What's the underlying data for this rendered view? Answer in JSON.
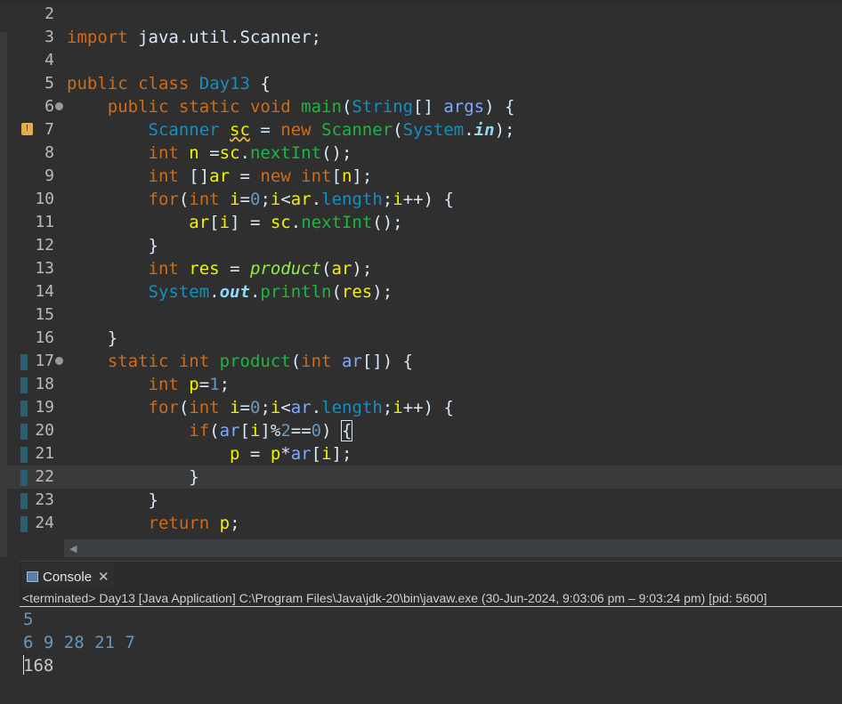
{
  "editor": {
    "lines": [
      {
        "n": "2",
        "tokens": []
      },
      {
        "n": "3",
        "tokens": [
          [
            "kw",
            "import"
          ],
          [
            "pl",
            " java.util.Scanner;"
          ]
        ]
      },
      {
        "n": "4",
        "tokens": []
      },
      {
        "n": "5",
        "tokens": [
          [
            "kw",
            "public"
          ],
          [
            "pl",
            " "
          ],
          [
            "kw",
            "class"
          ],
          [
            "pl",
            " "
          ],
          [
            "ty",
            "Day13"
          ],
          [
            "pl",
            " {"
          ]
        ]
      },
      {
        "n": "6",
        "fold": true,
        "tokens": [
          [
            "pl",
            "    "
          ],
          [
            "kw",
            "public"
          ],
          [
            "pl",
            " "
          ],
          [
            "kw",
            "static"
          ],
          [
            "pl",
            " "
          ],
          [
            "kw",
            "void"
          ],
          [
            "pl",
            " "
          ],
          [
            "fn",
            "main"
          ],
          [
            "pl",
            "("
          ],
          [
            "ty",
            "String"
          ],
          [
            "pl",
            "[] "
          ],
          [
            "var",
            "args"
          ],
          [
            "pl",
            ") {"
          ]
        ]
      },
      {
        "n": "7",
        "warn": true,
        "tokens": [
          [
            "pl",
            "        "
          ],
          [
            "ty",
            "Scanner"
          ],
          [
            "pl",
            " "
          ],
          [
            "loc squig",
            "sc"
          ],
          [
            "pl",
            " = "
          ],
          [
            "kw",
            "new"
          ],
          [
            "pl",
            " "
          ],
          [
            "fn",
            "Scanner"
          ],
          [
            "pl",
            "("
          ],
          [
            "ty",
            "System"
          ],
          [
            "pl",
            "."
          ],
          [
            "fldi",
            "in"
          ],
          [
            "pl",
            ");"
          ]
        ]
      },
      {
        "n": "8",
        "tokens": [
          [
            "pl",
            "        "
          ],
          [
            "kw",
            "int"
          ],
          [
            "pl",
            " "
          ],
          [
            "loc",
            "n"
          ],
          [
            "pl",
            " ="
          ],
          [
            "loc",
            "sc"
          ],
          [
            "pl",
            "."
          ],
          [
            "fn",
            "nextInt"
          ],
          [
            "pl",
            "();"
          ]
        ]
      },
      {
        "n": "9",
        "tokens": [
          [
            "pl",
            "        "
          ],
          [
            "kw",
            "int"
          ],
          [
            "pl",
            " []"
          ],
          [
            "loc",
            "ar"
          ],
          [
            "pl",
            " = "
          ],
          [
            "kw",
            "new"
          ],
          [
            "pl",
            " "
          ],
          [
            "kw",
            "int"
          ],
          [
            "pl",
            "["
          ],
          [
            "loc",
            "n"
          ],
          [
            "pl",
            "];"
          ]
        ]
      },
      {
        "n": "10",
        "tokens": [
          [
            "pl",
            "        "
          ],
          [
            "kw",
            "for"
          ],
          [
            "pl",
            "("
          ],
          [
            "kw",
            "int"
          ],
          [
            "pl",
            " "
          ],
          [
            "loc",
            "i"
          ],
          [
            "pl",
            "="
          ],
          [
            "num",
            "0"
          ],
          [
            "pl",
            ";"
          ],
          [
            "loc",
            "i"
          ],
          [
            "pl",
            "<"
          ],
          [
            "loc",
            "ar"
          ],
          [
            "pl",
            "."
          ],
          [
            "ty",
            "length"
          ],
          [
            "pl",
            ";"
          ],
          [
            "loc",
            "i"
          ],
          [
            "pl",
            "++) {"
          ]
        ]
      },
      {
        "n": "11",
        "tokens": [
          [
            "pl",
            "            "
          ],
          [
            "loc",
            "ar"
          ],
          [
            "pl",
            "["
          ],
          [
            "loc",
            "i"
          ],
          [
            "pl",
            "] = "
          ],
          [
            "loc",
            "sc"
          ],
          [
            "pl",
            "."
          ],
          [
            "fn",
            "nextInt"
          ],
          [
            "pl",
            "();"
          ]
        ]
      },
      {
        "n": "12",
        "tokens": [
          [
            "pl",
            "        }"
          ]
        ]
      },
      {
        "n": "13",
        "tokens": [
          [
            "pl",
            "        "
          ],
          [
            "kw",
            "int"
          ],
          [
            "pl",
            " "
          ],
          [
            "loc",
            "res"
          ],
          [
            "pl",
            " = "
          ],
          [
            "sta",
            "product"
          ],
          [
            "pl",
            "("
          ],
          [
            "loc",
            "ar"
          ],
          [
            "pl",
            ");"
          ]
        ]
      },
      {
        "n": "14",
        "tokens": [
          [
            "pl",
            "        "
          ],
          [
            "ty",
            "System"
          ],
          [
            "pl",
            "."
          ],
          [
            "fldi",
            "out"
          ],
          [
            "pl",
            "."
          ],
          [
            "fn",
            "println"
          ],
          [
            "pl",
            "("
          ],
          [
            "loc",
            "res"
          ],
          [
            "pl",
            ");"
          ]
        ]
      },
      {
        "n": "15",
        "tokens": []
      },
      {
        "n": "16",
        "tokens": [
          [
            "pl",
            "    }"
          ]
        ]
      },
      {
        "n": "17",
        "fold": true,
        "qd": true,
        "tokens": [
          [
            "pl",
            "    "
          ],
          [
            "kw",
            "static"
          ],
          [
            "pl",
            " "
          ],
          [
            "kw",
            "int"
          ],
          [
            "pl",
            " "
          ],
          [
            "fn",
            "product"
          ],
          [
            "pl",
            "("
          ],
          [
            "kw",
            "int"
          ],
          [
            "pl",
            " "
          ],
          [
            "var",
            "ar"
          ],
          [
            "pl",
            "[]) {"
          ]
        ]
      },
      {
        "n": "18",
        "qd": true,
        "tokens": [
          [
            "pl",
            "        "
          ],
          [
            "kw",
            "int"
          ],
          [
            "pl",
            " "
          ],
          [
            "loc",
            "p"
          ],
          [
            "pl",
            "="
          ],
          [
            "num",
            "1"
          ],
          [
            "pl",
            ";"
          ]
        ]
      },
      {
        "n": "19",
        "qd": true,
        "tokens": [
          [
            "pl",
            "        "
          ],
          [
            "kw",
            "for"
          ],
          [
            "pl",
            "("
          ],
          [
            "kw",
            "int"
          ],
          [
            "pl",
            " "
          ],
          [
            "loc",
            "i"
          ],
          [
            "pl",
            "="
          ],
          [
            "num",
            "0"
          ],
          [
            "pl",
            ";"
          ],
          [
            "loc",
            "i"
          ],
          [
            "pl",
            "<"
          ],
          [
            "var",
            "ar"
          ],
          [
            "pl",
            "."
          ],
          [
            "ty",
            "length"
          ],
          [
            "pl",
            ";"
          ],
          [
            "loc",
            "i"
          ],
          [
            "pl",
            "++) {"
          ]
        ]
      },
      {
        "n": "20",
        "qd": true,
        "tokens": [
          [
            "pl",
            "            "
          ],
          [
            "kw",
            "if"
          ],
          [
            "pl",
            "("
          ],
          [
            "var",
            "ar"
          ],
          [
            "pl",
            "["
          ],
          [
            "loc",
            "i"
          ],
          [
            "pl",
            "]%"
          ],
          [
            "num",
            "2"
          ],
          [
            "pl",
            "=="
          ],
          [
            "num",
            "0"
          ],
          [
            "pl",
            ") "
          ],
          [
            "pl boxed",
            "{"
          ]
        ]
      },
      {
        "n": "21",
        "qd": true,
        "tokens": [
          [
            "pl",
            "                "
          ],
          [
            "loc",
            "p"
          ],
          [
            "pl",
            " = "
          ],
          [
            "loc",
            "p"
          ],
          [
            "pl",
            "*"
          ],
          [
            "var",
            "ar"
          ],
          [
            "pl",
            "["
          ],
          [
            "loc",
            "i"
          ],
          [
            "pl",
            "];"
          ]
        ]
      },
      {
        "n": "22",
        "qd": true,
        "current": true,
        "tokens": [
          [
            "pl",
            "            }"
          ]
        ]
      },
      {
        "n": "23",
        "qd": true,
        "tokens": [
          [
            "pl",
            "        }"
          ]
        ]
      },
      {
        "n": "24",
        "qd": true,
        "tokens": [
          [
            "pl",
            "        "
          ],
          [
            "kw",
            "return"
          ],
          [
            "pl",
            " "
          ],
          [
            "loc",
            "p"
          ],
          [
            "pl",
            ";"
          ]
        ]
      }
    ]
  },
  "console": {
    "tab_label": "Console",
    "status": "<terminated> Day13 [Java Application] C:\\Program Files\\Java\\jdk-20\\bin\\javaw.exe  (30-Jun-2024, 9:03:06 pm – 9:03:24 pm) [pid: 5600]",
    "output": [
      "5",
      "6 9 28 21 7",
      "168"
    ]
  },
  "icons": {
    "console_tab": "console-icon",
    "close": "close-icon",
    "warning": "warning-icon",
    "scroll_left": "scroll-left-arrow-icon"
  }
}
